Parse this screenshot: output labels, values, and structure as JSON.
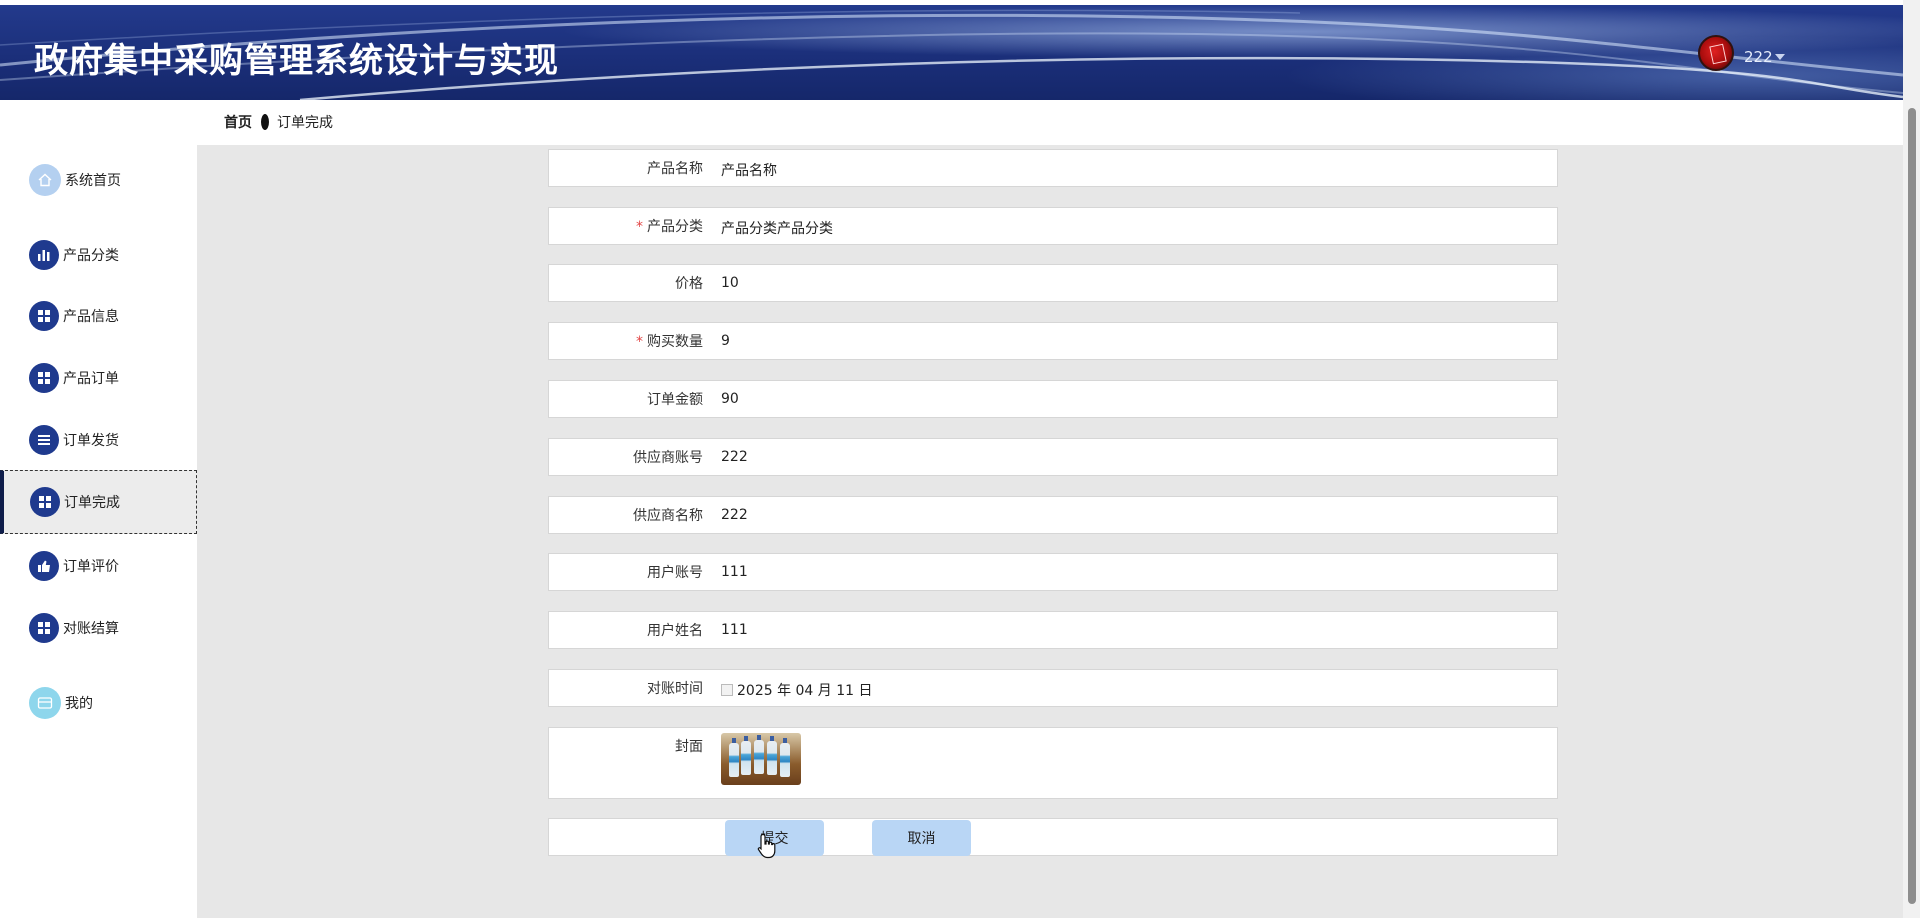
{
  "header": {
    "title": "政府集中采购管理系统设计与实现",
    "username": "222"
  },
  "breadcrumb": {
    "home": "首页",
    "current": "订单完成"
  },
  "sidebar": {
    "items": [
      {
        "label": "系统首页",
        "icon": "home-icon"
      },
      {
        "label": "产品分类",
        "icon": "bar-chart-icon"
      },
      {
        "label": "产品信息",
        "icon": "grid-icon"
      },
      {
        "label": "产品订单",
        "icon": "grid-icon"
      },
      {
        "label": "订单发货",
        "icon": "list-icon"
      },
      {
        "label": "订单完成",
        "icon": "grid-icon",
        "active": true
      },
      {
        "label": "订单评价",
        "icon": "thumbs-up-icon"
      },
      {
        "label": "对账结算",
        "icon": "grid-icon"
      },
      {
        "label": "我的",
        "icon": "card-icon"
      }
    ]
  },
  "form": {
    "fields": [
      {
        "label": "产品名称",
        "value": "产品名称",
        "required": false
      },
      {
        "label": "产品分类",
        "value": "产品分类产品分类",
        "required": true
      },
      {
        "label": "价格",
        "value": "10",
        "required": false
      },
      {
        "label": "购买数量",
        "value": "9",
        "required": true
      },
      {
        "label": "订单金额",
        "value": "90",
        "required": false
      },
      {
        "label": "供应商账号",
        "value": "222",
        "required": false
      },
      {
        "label": "供应商名称",
        "value": "222",
        "required": false
      },
      {
        "label": "用户账号",
        "value": "111",
        "required": false
      },
      {
        "label": "用户姓名",
        "value": "111",
        "required": false
      },
      {
        "label": "对账时间",
        "value": "2025 年 04 月 11 日",
        "required": false
      }
    ],
    "cover_label": "封面",
    "submit_label": "提交",
    "cancel_label": "取消",
    "required_mark": "*"
  },
  "colors": {
    "header_bg": "#1b2f7a",
    "icon_bg": "#1f3a8e",
    "button_bg": "#b9d6f5",
    "content_bg": "#e7e7e7",
    "required": "#e24545"
  }
}
